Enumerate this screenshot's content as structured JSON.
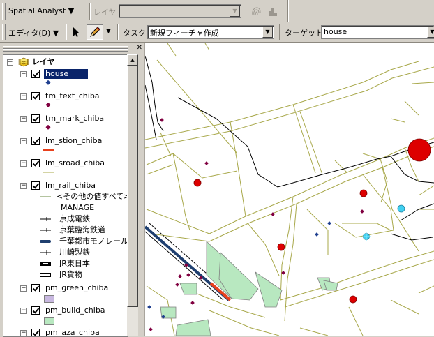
{
  "toolbar1": {
    "spatial_analyst": "Spatial Analyst ▼",
    "layer_label": "レイヤ",
    "layer_value": ""
  },
  "toolbar2": {
    "editor": "エディタ(D) ▼",
    "task_label": "タスク:",
    "task_value": "新規フィーチャ作成",
    "target_label": "ターゲット:",
    "target_value": "house"
  },
  "toc": {
    "root": "レイヤ",
    "layers": [
      {
        "name": "house",
        "selected": true
      },
      {
        "name": "tm_text_chiba"
      },
      {
        "name": "tm_mark_chiba"
      },
      {
        "name": "lm_stion_chiba"
      },
      {
        "name": "lm_sroad_chiba"
      },
      {
        "name": "lm_rail_chiba"
      },
      {
        "name": "pm_green_chiba"
      },
      {
        "name": "pm_build_chiba"
      },
      {
        "name": "pm_aza_chiba"
      }
    ],
    "rail_legend": [
      "<その他の値すべて>",
      "MANAGE",
      "京成電鉄",
      "京葉臨海鉄道",
      "千葉都市モノレール",
      "川崎製鉄",
      "JR東日本",
      "JR貨物"
    ]
  },
  "colors": {
    "selection": "#0a246a",
    "house_point": "#1f3f8f",
    "mark_point": "#800040",
    "station_line": "#e8401c",
    "road_line": "#a8a84a",
    "green_fill": "#c8b8e0",
    "build_fill": "#b8e8c0",
    "big_circle": "#dd0000",
    "cyan_circle": "#40d0f0",
    "rail_line": "#1f3f6f"
  }
}
